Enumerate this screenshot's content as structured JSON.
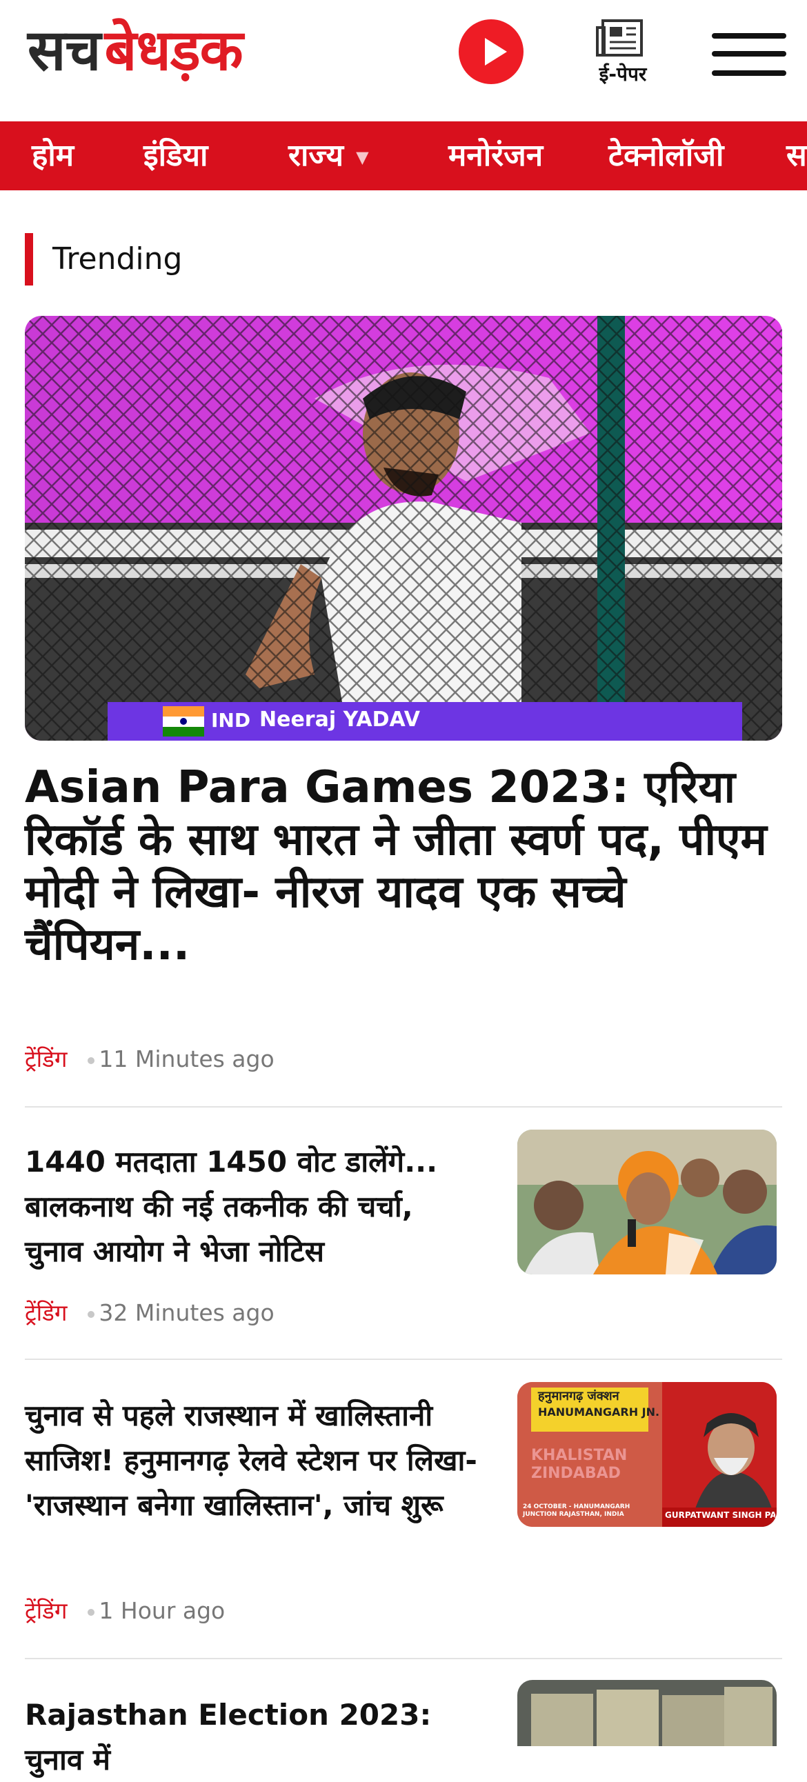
{
  "brand": {
    "part1": "सच",
    "part2": "बेधड़क"
  },
  "header": {
    "epaper_label": "ई-पेपर"
  },
  "nav": {
    "items": [
      "होम",
      "इंडिया",
      "राज्य",
      "मनोरंजन",
      "टेक्नोलॉजी",
      "स"
    ]
  },
  "section": {
    "title": "Trending"
  },
  "hero": {
    "title": "Asian Para Games 2023: एरिया रिकॉर्ड के साथ भारत ने जीता स्वर्ण पद, पीएम मोदी ने लिखा- नीरज यादव एक सच्चे चैंपियन...",
    "category": "ट्रेंडिंग",
    "time": "11 Minutes ago",
    "image_caption": {
      "country": "IND",
      "name": "Neeraj YADAV"
    }
  },
  "articles": [
    {
      "title": "1440 मतदाता 1450 वोट डालेंगे... बालकनाथ की नई तकनीक की चर्चा, चुनाव आयोग ने भेजा नोटिस",
      "category": "ट्रेंडिंग",
      "time": "32 Minutes ago"
    },
    {
      "title": "चुनाव से पहले राजस्थान में खालिस्तानी साजिश! हनुमानगढ़ रेलवे स्टेशन पर लिखा- 'राजस्थान बनेगा खालिस्तान', जांच शुरू",
      "category": "ट्रेंडिंग",
      "time": "1 Hour ago",
      "image_text": {
        "station_hindi": "हनुमानगढ़ जंक्शन",
        "station_english": "HANUMANGARH JN.",
        "wall_text": "KHALISTAN ZINDABAD",
        "date_caption": "24 OCTOBER - HANUMANGARH JUNCTION RAJASTHAN, INDIA",
        "person_caption": "GURPATWANT SINGH PANNUN"
      }
    },
    {
      "title": "Rajasthan Election 2023: चुनाव में",
      "category": "",
      "time": ""
    }
  ],
  "colors": {
    "brand_red": "#d8101d",
    "play_red": "#ee1c25",
    "text_gray": "#777777"
  }
}
